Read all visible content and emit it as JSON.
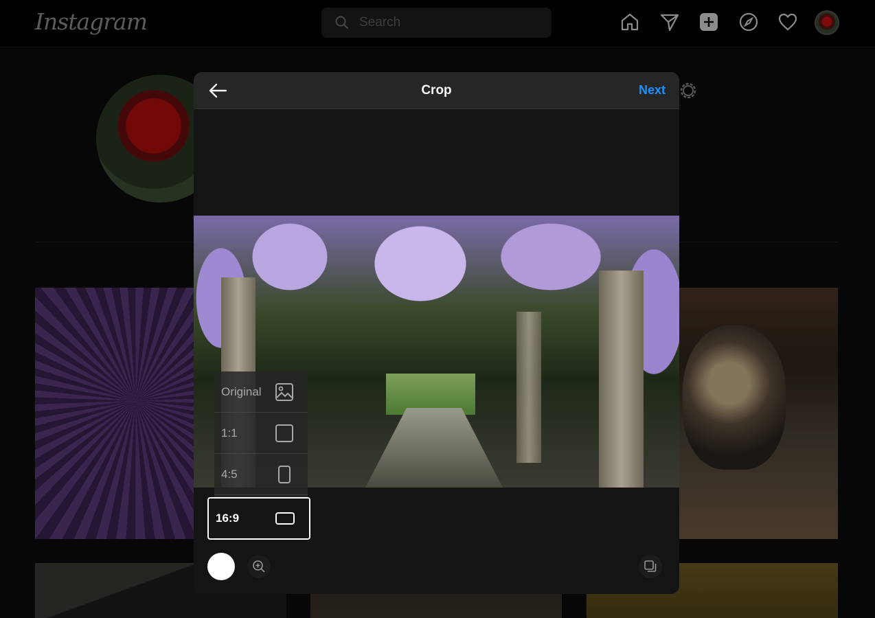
{
  "app": {
    "logo_text": "Instagram"
  },
  "search": {
    "placeholder": "Search"
  },
  "nav": {
    "icons": [
      "home-icon",
      "direct-icon",
      "new-post-icon",
      "explore-icon",
      "activity-icon",
      "profile-avatar"
    ]
  },
  "modal": {
    "title": "Crop",
    "next_label": "Next",
    "aspect_ratios": [
      {
        "label": "Original",
        "icon": "image-icon"
      },
      {
        "label": "1:1",
        "icon": "square-icon"
      },
      {
        "label": "4:5",
        "icon": "portrait-icon"
      },
      {
        "label": "16:9",
        "icon": "landscape-icon"
      }
    ],
    "selected_ratio": "16:9"
  },
  "colors": {
    "accent": "#1e90ff",
    "header": "#262626",
    "modal_bg": "#141414"
  }
}
